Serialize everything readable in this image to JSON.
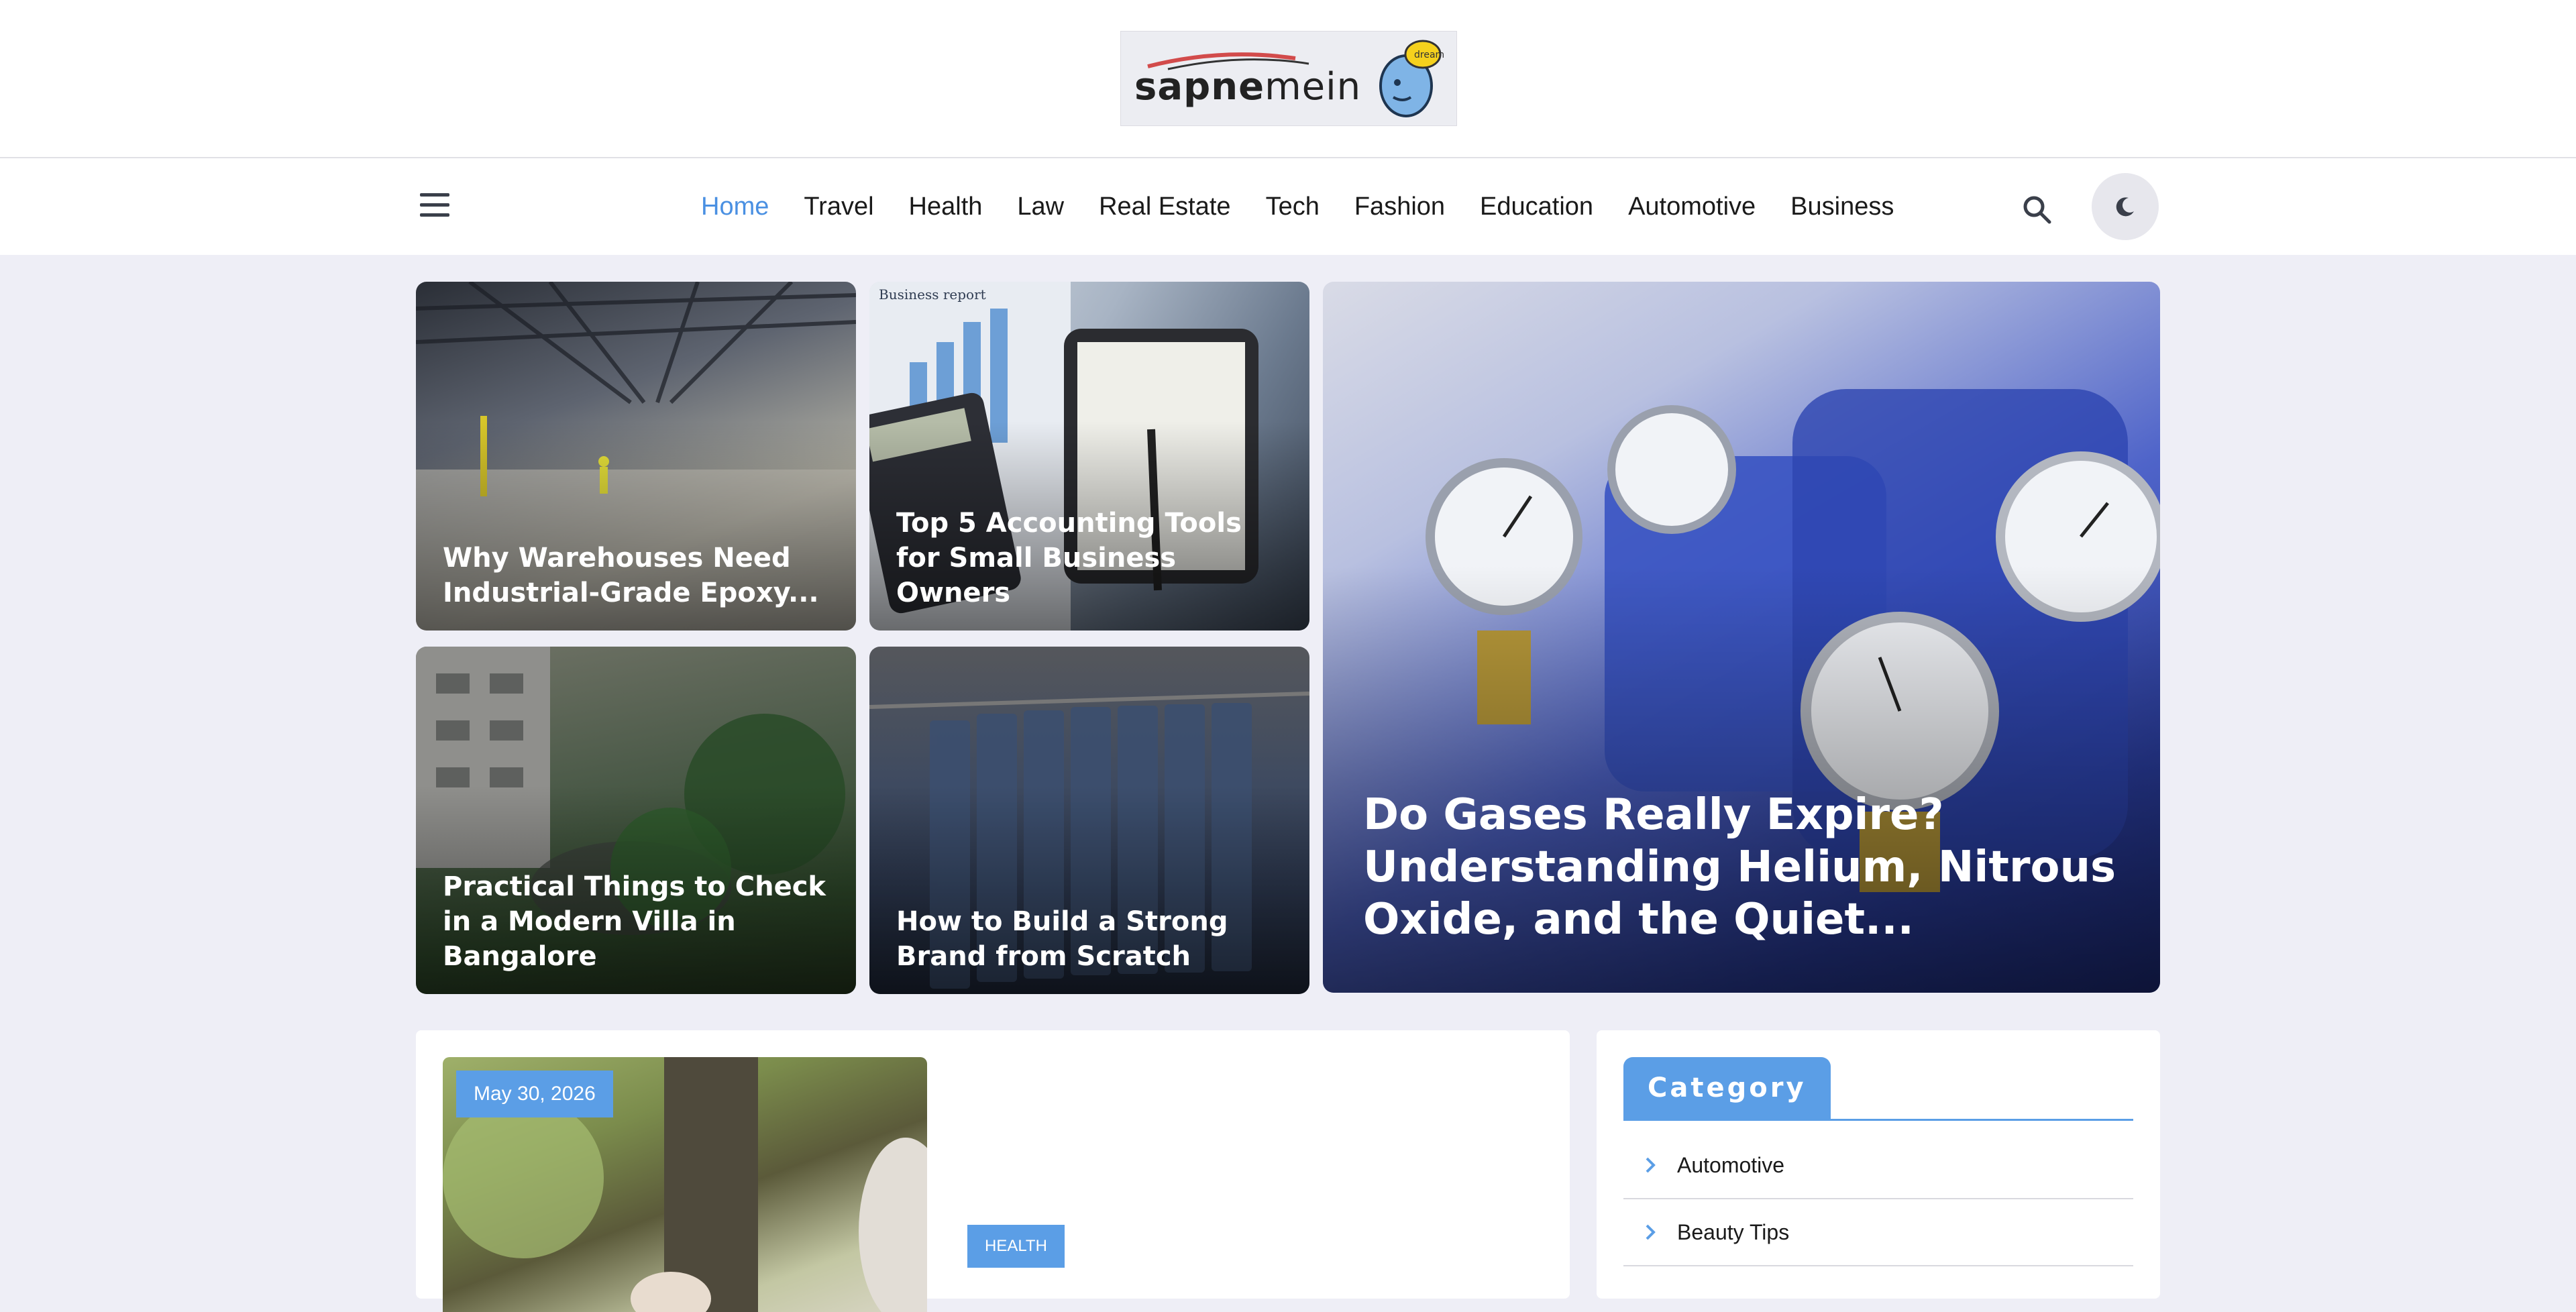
{
  "header": {
    "logo": {
      "bold": "sapne",
      "light": "mein",
      "mascot_tag": "dream"
    }
  },
  "nav": {
    "items": [
      {
        "label": "Home",
        "active": true
      },
      {
        "label": "Travel"
      },
      {
        "label": "Health"
      },
      {
        "label": "Law"
      },
      {
        "label": "Real Estate"
      },
      {
        "label": "Tech"
      },
      {
        "label": "Fashion"
      },
      {
        "label": "Education"
      },
      {
        "label": "Automotive"
      },
      {
        "label": "Business"
      }
    ],
    "icons": {
      "menu": "hamburger-icon",
      "search": "search-icon",
      "theme": "moon-icon"
    }
  },
  "featured": [
    {
      "title": "Why Warehouses Need Industrial-Grade Epoxy..."
    },
    {
      "title": "Top 5 Accounting Tools for Small Business Owners",
      "image_text": "Business report"
    },
    {
      "title": "Practical Things to Check in a Modern Villa in Bangalore"
    },
    {
      "title": "How to Build a Strong Brand from Scratch"
    },
    {
      "title": "Do Gases Really Expire? Understanding Helium, Nitrous Oxide, and the Quiet..."
    }
  ],
  "post": {
    "date": "May 30, 2026",
    "category": "HEALTH"
  },
  "sidebar": {
    "title": "Category",
    "categories": [
      "Automotive",
      "Beauty Tips"
    ]
  },
  "colors": {
    "accent": "#5b9ee6",
    "nav_active": "#4a90e2",
    "page_bg": "#eeeef6"
  }
}
